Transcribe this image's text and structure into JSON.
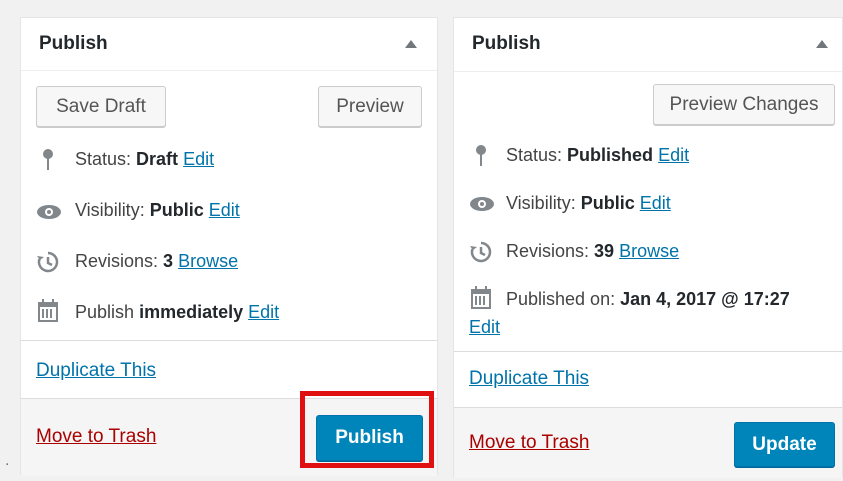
{
  "left_box": {
    "title": "Publish",
    "save_draft": "Save Draft",
    "preview": "Preview",
    "status_label": "Status:",
    "status_value": "Draft",
    "status_edit": "Edit",
    "visibility_label": "Visibility:",
    "visibility_value": "Public",
    "visibility_edit": "Edit",
    "revisions_label": "Revisions:",
    "revisions_value": "3",
    "revisions_browse": "Browse",
    "publish_label": "Publish",
    "publish_value": "immediately",
    "publish_edit": "Edit",
    "duplicate": "Duplicate This",
    "trash": "Move to Trash",
    "publish_button": "Publish"
  },
  "right_box": {
    "title": "Publish",
    "preview_changes": "Preview Changes",
    "status_label": "Status:",
    "status_value": "Published",
    "status_edit": "Edit",
    "visibility_label": "Visibility:",
    "visibility_value": "Public",
    "visibility_edit": "Edit",
    "revisions_label": "Revisions:",
    "revisions_value": "39",
    "revisions_browse": "Browse",
    "published_on_label": "Published on:",
    "published_on_value": "Jan 4, 2017 @ 17:27",
    "published_on_edit": "Edit",
    "duplicate": "Duplicate This",
    "trash": "Move to Trash",
    "update_button": "Update"
  },
  "colors": {
    "link": "#0073aa",
    "trash": "#a00",
    "primary": "#0085ba",
    "highlight": "#e01010"
  },
  "icons": [
    "pin-icon",
    "eye-icon",
    "history-icon",
    "calendar-icon",
    "collapse-arrow-icon"
  ],
  "corner_mark": "."
}
